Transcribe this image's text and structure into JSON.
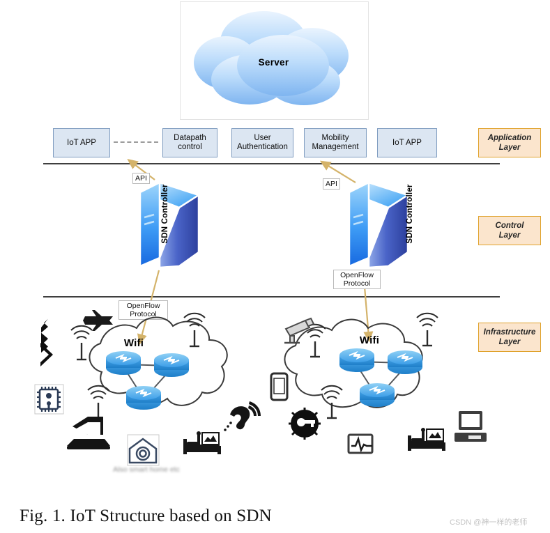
{
  "figure": {
    "caption": "Fig. 1. IoT Structure based on SDN",
    "watermark": "CSDN @神一样的老师"
  },
  "server": {
    "label": "Server",
    "shape": "cloud",
    "fill_top": "#e8f2fd",
    "fill_bottom": "#7db3ef"
  },
  "layers": [
    {
      "id": "application",
      "tag": "Application\nLayer",
      "line1": "Application",
      "line2": "Layer"
    },
    {
      "id": "control",
      "tag": "Control Layer",
      "line1": "Control",
      "line2": "Layer"
    },
    {
      "id": "infrastructure",
      "tag": "Infrastructure Layer",
      "line1": "Infrastructure",
      "line2": "Layer"
    }
  ],
  "application_layer": {
    "boxes": [
      {
        "id": "iot-app-1",
        "line1": "IoT APP",
        "line2": ""
      },
      {
        "id": "datapath",
        "line1": "Datapath",
        "line2": "control"
      },
      {
        "id": "user-auth",
        "line1": "User",
        "line2": "Authentication"
      },
      {
        "id": "mobility",
        "line1": "Mobility",
        "line2": "Management"
      },
      {
        "id": "iot-app-2",
        "line1": "IoT APP",
        "line2": ""
      }
    ],
    "connector_style": "dashed",
    "box_fill": "#dce6f2",
    "box_border": "#7f9cc0"
  },
  "control_layer": {
    "controllers": [
      {
        "id": "sdn-controller-left",
        "label": "SDN Controller",
        "label_side": "left"
      },
      {
        "id": "sdn-controller-right",
        "label": "SDN Controller",
        "label_side": "right"
      }
    ],
    "northbound_labels": [
      {
        "id": "api-left",
        "text": "API"
      },
      {
        "id": "api-right",
        "text": "API"
      }
    ],
    "southbound_labels": [
      {
        "id": "openflow-left",
        "line1": "OpenFlow",
        "line2": "Protocol"
      },
      {
        "id": "openflow-right",
        "line1": "OpenFlow",
        "line2": "Protocol"
      }
    ],
    "arrow_color": "#d4b36a"
  },
  "infrastructure_layer": {
    "clouds": [
      {
        "id": "cloud-left",
        "label": "Wifi",
        "router_count": 3,
        "access_point_count": 3,
        "devices": [
          {
            "name": "airplane-icon",
            "label": ""
          },
          {
            "name": "bluetooth-icon",
            "label": ""
          },
          {
            "name": "chip-icon",
            "label": ""
          },
          {
            "name": "laptop-icon",
            "label": ""
          },
          {
            "name": "smart-home-icon",
            "label": ""
          },
          {
            "name": "hospital-bed-icon",
            "label": ""
          },
          {
            "name": "hearing-ear-icon",
            "label": ""
          }
        ]
      },
      {
        "id": "cloud-right",
        "label": "Wifi",
        "router_count": 3,
        "access_point_count": 3,
        "devices": [
          {
            "name": "cctv-camera-icon",
            "label": ""
          },
          {
            "name": "smartphone-icon",
            "label": ""
          },
          {
            "name": "key-badge-icon",
            "label": ""
          },
          {
            "name": "ecg-monitor-icon",
            "label": ""
          },
          {
            "name": "hospital-bed-icon",
            "label": ""
          },
          {
            "name": "desktop-computer-icon",
            "label": ""
          }
        ]
      }
    ],
    "home_caption_blurred": "Also smart home etc",
    "router_color": "#3d9ee8"
  },
  "colors": {
    "divider": "#3f3f3f",
    "layer_tag_fill": "#fbe5cd",
    "layer_tag_border": "#e0a22c",
    "cloud_outline": "#3a3a3a"
  }
}
